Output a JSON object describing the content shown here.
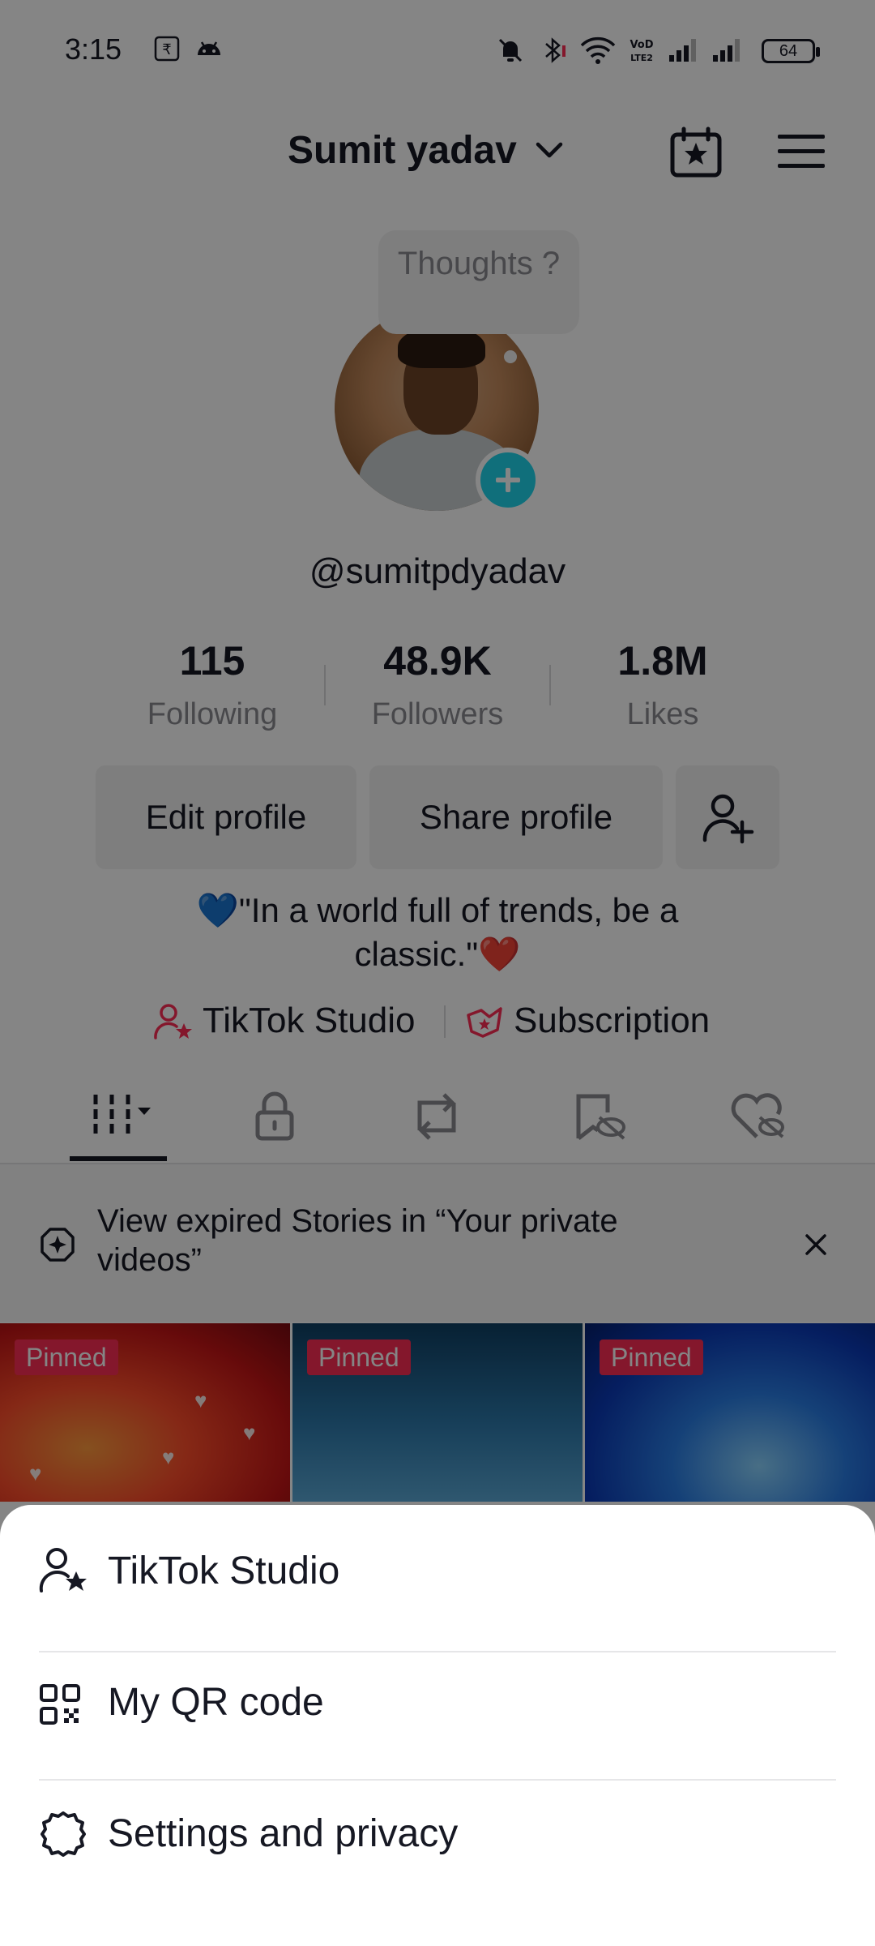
{
  "status_bar": {
    "time": "3:15",
    "battery": "64",
    "icons": [
      "rupee-icon",
      "android-icon",
      "bell-off-icon",
      "bluetooth-icon",
      "wifi-icon",
      "volte-icon",
      "signal-icon",
      "signal-icon"
    ]
  },
  "header": {
    "account_name": "Sumit yadav",
    "icons": [
      "chevron-down-icon",
      "calendar-star-icon",
      "menu-icon"
    ]
  },
  "profile": {
    "thought_bubble": "Thoughts ?",
    "username": "@sumitpdyadav",
    "stats": [
      {
        "value": "115",
        "label": "Following"
      },
      {
        "value": "48.9K",
        "label": "Followers"
      },
      {
        "value": "1.8M",
        "label": "Likes"
      }
    ],
    "buttons": {
      "edit": "Edit profile",
      "share": "Share profile"
    },
    "bio_line1": "💙\"In a world full of trends, be a",
    "bio_line2": "classic.\"❤️",
    "links": {
      "studio": "TikTok Studio",
      "subscription": "Subscription"
    }
  },
  "tabs": [
    "videos-grid-icon",
    "lock-icon",
    "repost-icon",
    "hidden-icon",
    "liked-hidden-icon"
  ],
  "banner": {
    "text": "View expired Stories in “Your private videos”"
  },
  "videos": [
    {
      "badge": "Pinned"
    },
    {
      "badge": "Pinned"
    },
    {
      "badge": "Pinned"
    }
  ],
  "menu": {
    "items": [
      {
        "label": "TikTok Studio",
        "icon": "user-star-icon"
      },
      {
        "label": "My QR code",
        "icon": "qr-code-icon"
      },
      {
        "label": "Settings and privacy",
        "icon": "gear-icon"
      }
    ]
  },
  "colors": {
    "brand_pink": "#fe2c55",
    "story_add": "#20d5ec",
    "text_primary": "#161823",
    "text_secondary": "#8a8b91"
  }
}
